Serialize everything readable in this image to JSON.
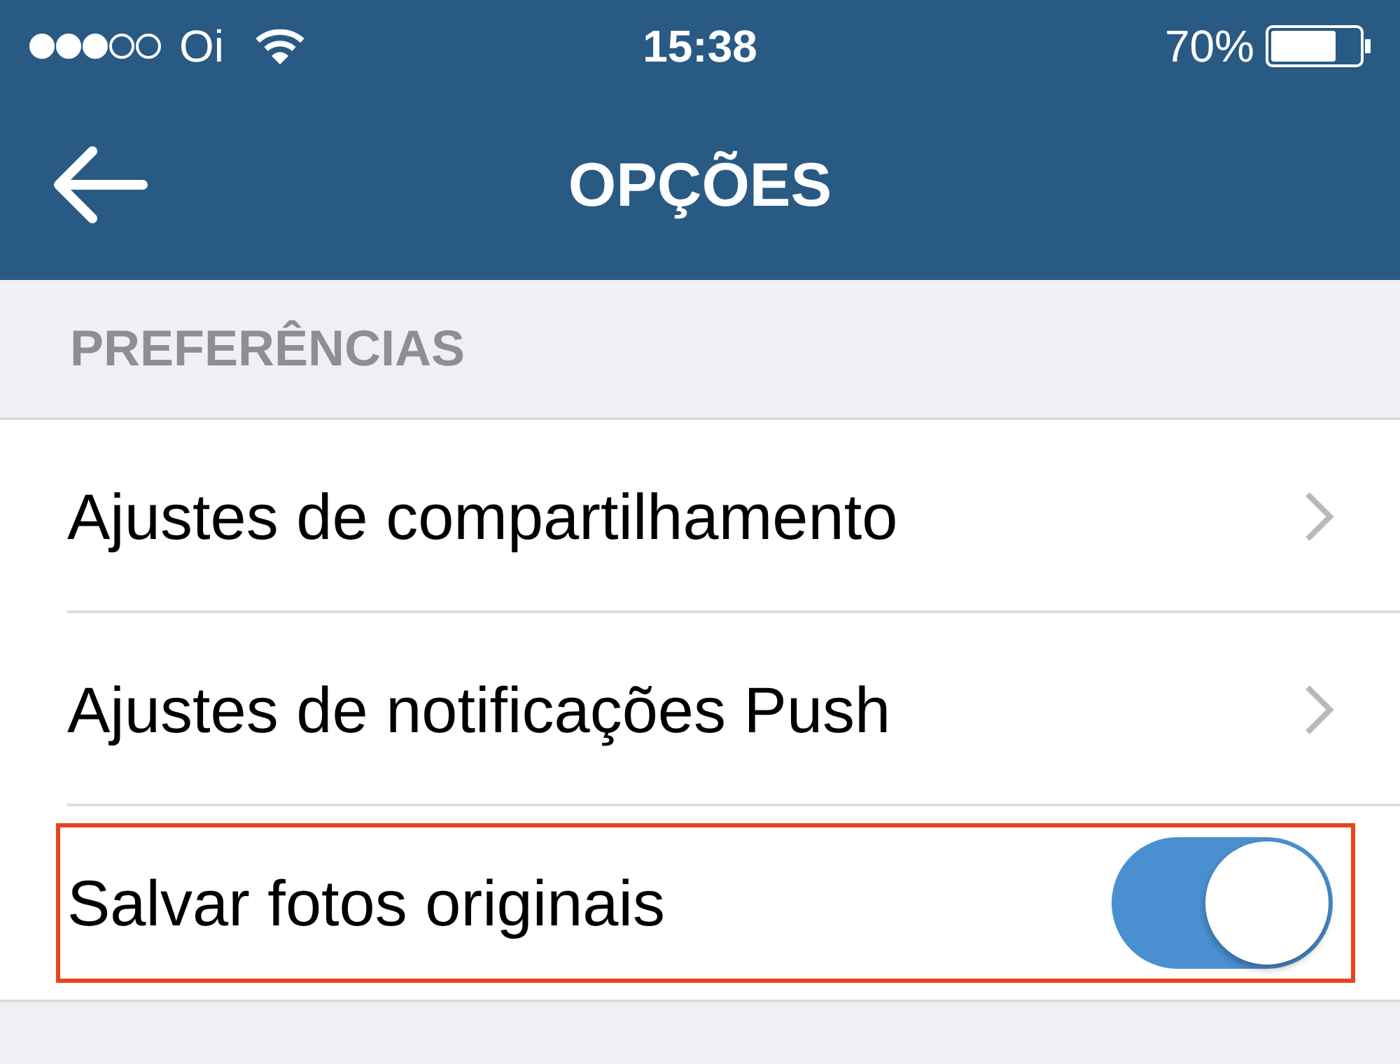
{
  "status_bar": {
    "carrier": "Oi",
    "time": "15:38",
    "battery": "70%"
  },
  "nav_bar": {
    "title": "OPÇÕES"
  },
  "section": {
    "header": "PREFERÊNCIAS"
  },
  "rows": [
    {
      "kind": "link",
      "label": "Ajustes de compartilhamento",
      "highlighted": false
    },
    {
      "kind": "link",
      "label": "Ajustes de notificações Push",
      "highlighted": false
    },
    {
      "kind": "toggle",
      "label": "Salvar fotos originais",
      "on": true,
      "highlighted": true
    }
  ]
}
